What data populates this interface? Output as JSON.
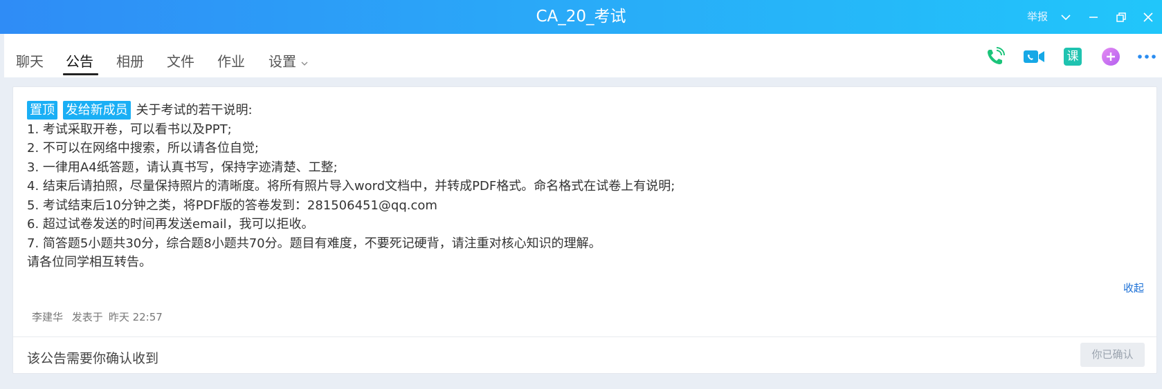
{
  "window": {
    "title": "CA_20_考试",
    "report_label": "举报"
  },
  "tabs": [
    {
      "label": "聊天"
    },
    {
      "label": "公告"
    },
    {
      "label": "相册"
    },
    {
      "label": "文件"
    },
    {
      "label": "作业"
    },
    {
      "label": "设置"
    }
  ],
  "active_tab": "公告",
  "toolbar": {
    "class_icon_label": "课"
  },
  "notice": {
    "tags": [
      "置顶",
      "发给新成员"
    ],
    "title": "关于考试的若干说明:",
    "lines": [
      "1. 考试采取开卷，可以看书以及PPT;",
      "2. 不可以在网络中搜索，所以请各位自觉;",
      "3. 一律用A4纸答题，请认真书写，保持字迹清楚、工整;",
      "4. 结束后请拍照，尽量保持照片的清晰度。将所有照片导入word文档中，并转成PDF格式。命名格式在试卷上有说明;",
      "5. 考试结束后10分钟之类，将PDF版的答卷发到：281506451@qq.com",
      "6. 超过试卷发送的时间再发送email，我可以拒收。",
      "7. 简答题5小题共30分，综合题8小题共70分。题目有难度，不要死记硬背，请注重对核心知识的理解。",
      "请各位同学相互转告。"
    ],
    "collapse_label": "收起",
    "author": "李建华",
    "posted_label": "发表于",
    "posted_time": "昨天 22:57",
    "confirm_prompt": "该公告需要你确认收到",
    "confirm_button": "你已确认"
  },
  "colors": {
    "titlebar_start": "#2f8cf6",
    "titlebar_end": "#21c6fa",
    "tag_bg": "#1aaff5",
    "link": "#1a6fd6"
  }
}
